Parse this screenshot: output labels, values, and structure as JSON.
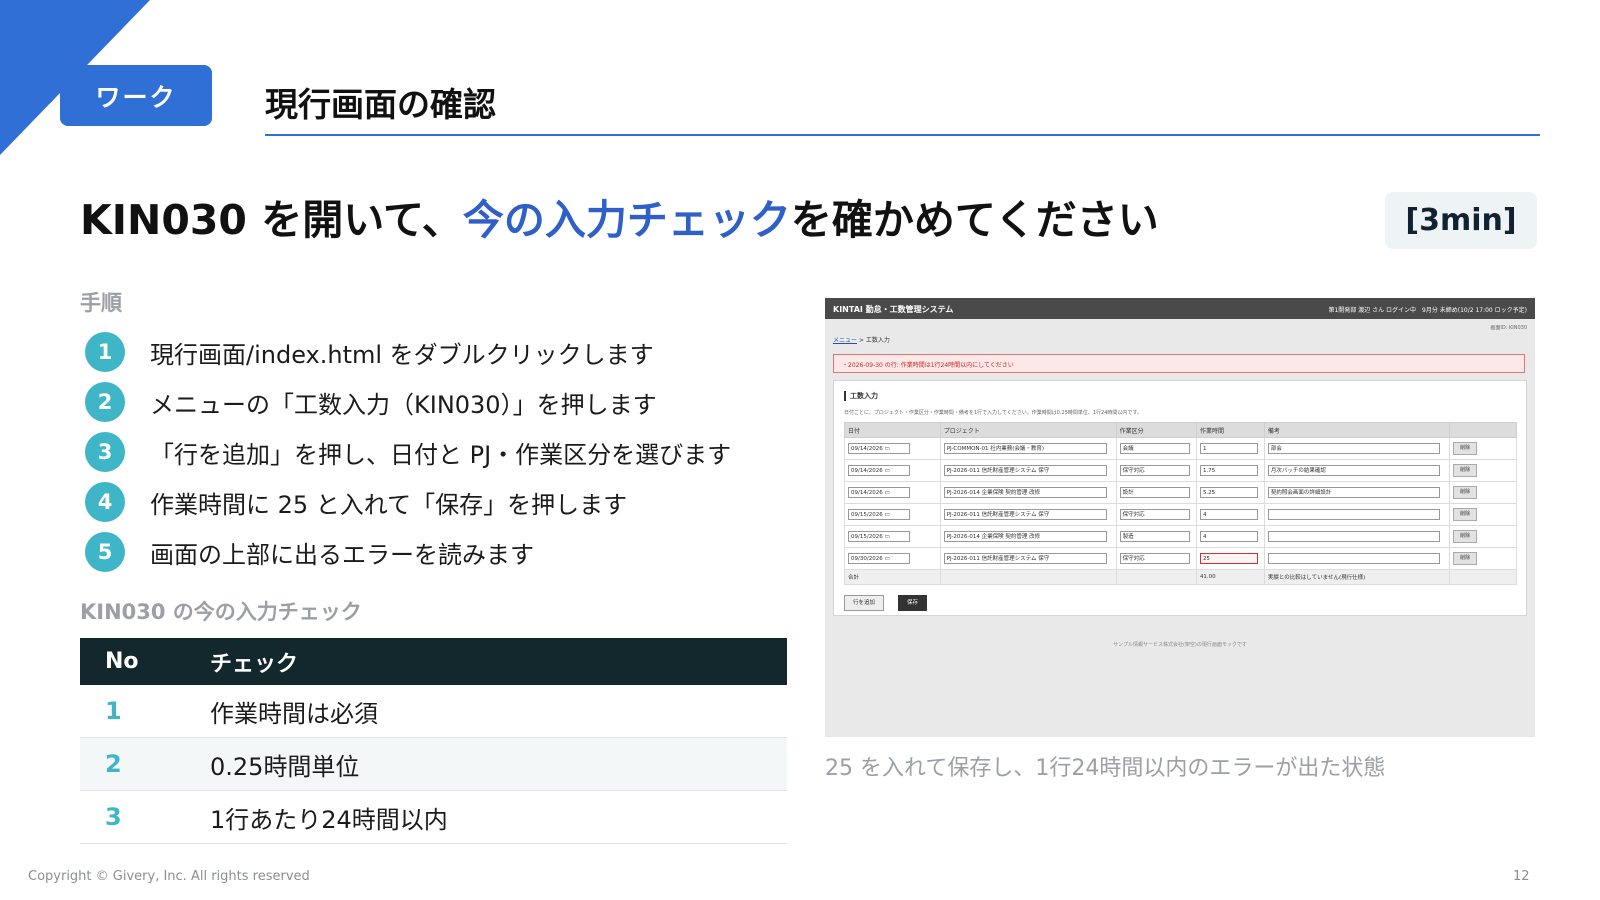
{
  "badge": "ワーク",
  "title": "現行画面の確認",
  "headline": {
    "pre": "KIN030 を開いて、",
    "accent": "今の入力チェック",
    "post": "を確かめてください"
  },
  "timer": "[3min]",
  "steps_label": "手順",
  "steps": [
    {
      "num": "1",
      "text": "現行画面/index.html をダブルクリックします"
    },
    {
      "num": "2",
      "text": "メニューの「工数入力（KIN030）」を押します"
    },
    {
      "num": "3",
      "text": "「行を追加」を押し、日付と PJ・作業区分を選びます"
    },
    {
      "num": "4",
      "text": "作業時間に 25 と入れて「保存」を押します"
    },
    {
      "num": "5",
      "text": "画面の上部に出るエラーを読みます"
    }
  ],
  "checks_label": "KIN030 の今の入力チェック",
  "checks": {
    "headers": [
      "No",
      "チェック"
    ],
    "rows": [
      {
        "no": "1",
        "check": "作業時間は必須"
      },
      {
        "no": "2",
        "check": "0.25時間単位"
      },
      {
        "no": "3",
        "check": "1行あたり24時間以内"
      }
    ]
  },
  "screenshot": {
    "app_title": "KINTAI 勤怠・工数管理システム",
    "user_info": "第1開発部 渡辺 さん ログイン中　9月分 未締め(10/2 17:00 ロック予定)",
    "screen_id": "画面ID: KIN030",
    "crumb_menu": "メニュー",
    "crumb_sep": " > ",
    "crumb_page": "工数入力",
    "error": "・2026-09-30 の行: 作業時間は1行24時間以内にしてください",
    "panel_title": "工数入力",
    "hint": "日付ごとに、プロジェクト・作業区分・作業時間・備考を1行で入力してください。作業時間は0.25時間単位、1行24時間以内です。",
    "headers": [
      "日付",
      "プロジェクト",
      "作業区分",
      "作業時間",
      "備考",
      ""
    ],
    "rows": [
      {
        "date": "09/14/2026",
        "project": "PJ-COMMON-01 社内業務(会議・教育)",
        "category": "会議",
        "hours": "1",
        "note": "部会",
        "del": "削除"
      },
      {
        "date": "09/14/2026",
        "project": "PJ-2026-011 信託財産管理システム 保守",
        "category": "保守対応",
        "hours": "1.75",
        "note": "月次バッチの結果確認",
        "del": "削除"
      },
      {
        "date": "09/14/2026",
        "project": "PJ-2026-014 企業保険 契約管理 改修",
        "category": "設計",
        "hours": "5.25",
        "note": "契約照会画面の詳細設計",
        "del": "削除"
      },
      {
        "date": "09/15/2026",
        "project": "PJ-2026-011 信託財産管理システム 保守",
        "category": "保守対応",
        "hours": "4",
        "note": "",
        "del": "削除"
      },
      {
        "date": "09/15/2026",
        "project": "PJ-2026-014 企業保険 契約管理 改修",
        "category": "製造",
        "hours": "4",
        "note": "",
        "del": "削除"
      },
      {
        "date": "09/30/2026",
        "project": "PJ-2026-011 信託財産管理システム 保守",
        "category": "保守対応",
        "hours": "25",
        "note": "",
        "del": "削除"
      }
    ],
    "total_label": "合計",
    "total_hours": "41.00",
    "total_note": "実績との比較はしていません(現行仕様)",
    "add_button": "行を追加",
    "save_button": "保存",
    "footer": "サンプル情報サービス株式会社(架空)の現行画面モックです"
  },
  "caption": "25 を入れて保存し、1行24時間以内のエラーが出た状態",
  "footer": "Copyright © Givery, Inc. All rights reserved",
  "page_number": "12",
  "colors": {
    "accent": "#2f6fd6",
    "teal": "#3fb5c8",
    "dark_header": "#13282c"
  }
}
